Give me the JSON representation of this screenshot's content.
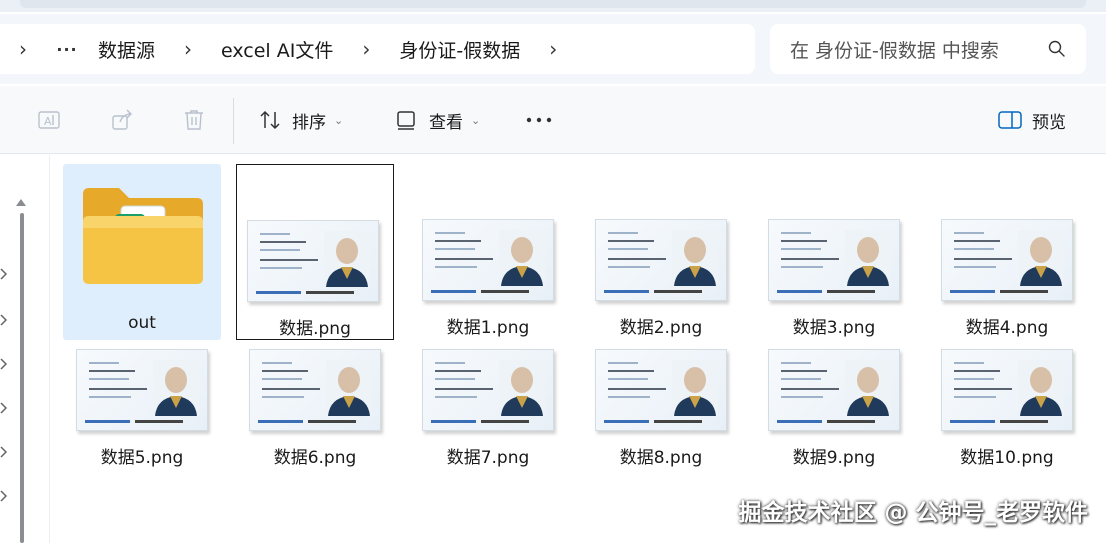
{
  "breadcrumb": {
    "items": [
      "数据源",
      "excel AI文件",
      "身份证-假数据"
    ]
  },
  "search": {
    "placeholder": "在 身份证-假数据 中搜索"
  },
  "toolbar": {
    "sort_label": "排序",
    "view_label": "查看",
    "preview_label": "预览"
  },
  "files": {
    "folder": {
      "name": "out"
    },
    "items": [
      {
        "name": "数据.png"
      },
      {
        "name": "数据1.png"
      },
      {
        "name": "数据2.png"
      },
      {
        "name": "数据3.png"
      },
      {
        "name": "数据4.png"
      },
      {
        "name": "数据5.png"
      },
      {
        "name": "数据6.png"
      },
      {
        "name": "数据7.png"
      },
      {
        "name": "数据8.png"
      },
      {
        "name": "数据9.png"
      },
      {
        "name": "数据10.png"
      }
    ]
  },
  "watermark": "掘金技术社区 @ 公钟号_老罗软件",
  "colors": {
    "folder_selection": "#dfeefc",
    "folder_yellow": "#f6c444",
    "excel_green": "#1d9f6b",
    "accent_blue": "#0067c0"
  },
  "icons": {
    "chevron": "chevron-right-icon",
    "search": "search-icon",
    "rename": "rename-icon",
    "share": "share-icon",
    "delete": "delete-icon",
    "sort": "sort-icon",
    "view": "view-icon",
    "more": "more-icon",
    "preview": "preview-pane-icon"
  }
}
